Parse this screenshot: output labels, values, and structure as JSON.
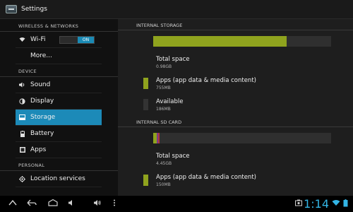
{
  "action_bar": {
    "title": "Settings"
  },
  "left": {
    "sections": [
      {
        "header": "WIRELESS & NETWORKS"
      },
      {
        "header": "DEVICE"
      },
      {
        "header": "PERSONAL"
      }
    ],
    "wifi": {
      "label": "Wi-Fi",
      "toggle": "ON"
    },
    "more": {
      "label": "More..."
    },
    "device_items": [
      {
        "label": "Sound",
        "icon": "speaker-icon"
      },
      {
        "label": "Display",
        "icon": "brightness-icon"
      },
      {
        "label": "Storage",
        "icon": "storage-icon",
        "selected": true
      },
      {
        "label": "Battery",
        "icon": "battery-icon"
      },
      {
        "label": "Apps",
        "icon": "apps-icon"
      }
    ],
    "personal_items": [
      {
        "label": "Location services",
        "icon": "location-icon"
      }
    ]
  },
  "right": {
    "internal": {
      "header": "INTERNAL STORAGE",
      "used_fraction": 0.75,
      "rows": [
        {
          "title": "Total space",
          "value": "0.98GB",
          "color": ""
        },
        {
          "title": "Apps (app data & media content)",
          "value": "755MB",
          "color": "#8fa31e"
        },
        {
          "title": "Available",
          "value": "186MB",
          "color": "#333333"
        }
      ]
    },
    "sdcard": {
      "header": "INTERNAL SD CARD",
      "rows": [
        {
          "title": "Total space",
          "value": "4.45GB",
          "color": ""
        },
        {
          "title": "Apps (app data & media content)",
          "value": "150MB",
          "color": "#8fa31e"
        }
      ]
    }
  },
  "status": {
    "time": "1:14"
  },
  "colors": {
    "accent": "#1c8ab8",
    "apps": "#8fa31e",
    "clock": "#33b5e5"
  }
}
